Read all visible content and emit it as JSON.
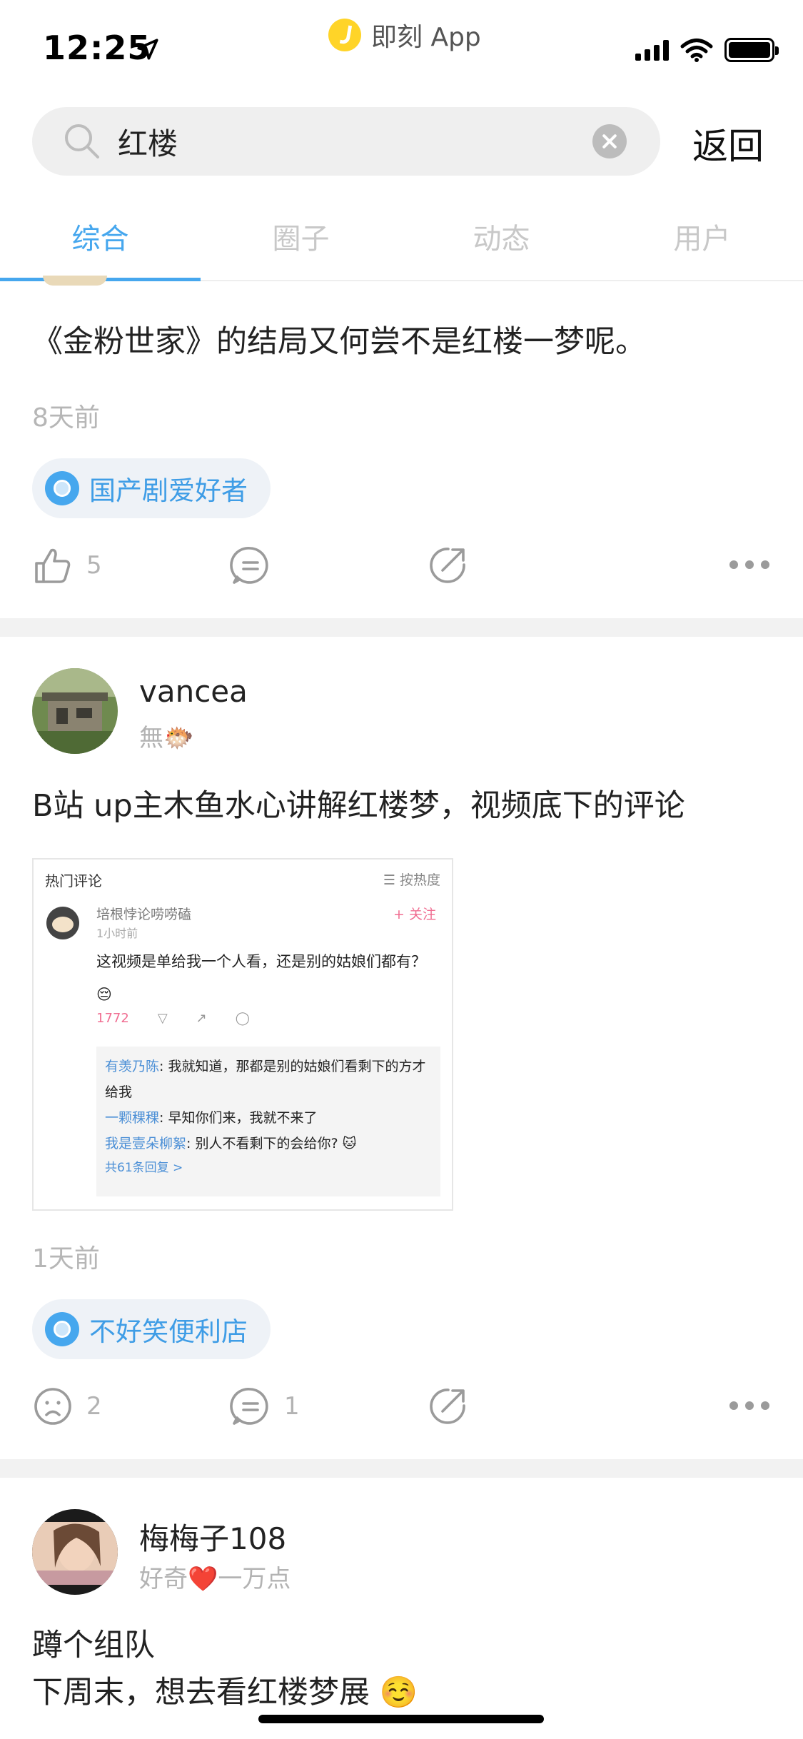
{
  "status_bar": {
    "time": "12:25",
    "app_name": "即刻 App"
  },
  "search": {
    "query": "红楼",
    "back_label": "返回"
  },
  "tabs": [
    {
      "label": "综合",
      "active": true
    },
    {
      "label": "圈子",
      "active": false
    },
    {
      "label": "动态",
      "active": false
    },
    {
      "label": "用户",
      "active": false
    }
  ],
  "colors": {
    "accent": "#46a7ee",
    "pill_bg": "#eef2f7",
    "muted": "#b6b6b6"
  },
  "posts": [
    {
      "text": "《金粉世家》的结局又何尝不是红楼一梦呢。",
      "time": "8天前",
      "topic": "国产剧爱好者",
      "like_count": "5",
      "comment_count": "",
      "like_icon": "thumbs-up-icon"
    },
    {
      "user": {
        "name": "vancea",
        "subtitle": "無🐡"
      },
      "text": "B站 up主木鱼水心讲解红楼梦，视频底下的评论",
      "image": {
        "header": "热门评论",
        "sort": "☰ 按热度",
        "commenter": "培根悖论唠唠磕",
        "comment_time": "1小时前",
        "follow": "+ 关注",
        "comment": "这视频是单给我一个人看，还是别的姑娘们都有？😔",
        "likes": "1772",
        "replies": [
          {
            "name": "有羡乃陈",
            "text": ": 我就知道，那都是别的姑娘们看剩下的方才给我"
          },
          {
            "name": "一颗稞稞",
            "text": ": 早知你们来，我就不来了"
          },
          {
            "name": "我是壹朵柳絮",
            "text": ": 别人不看剩下的会给你? 🐱"
          }
        ],
        "more_replies": "共61条回复 >"
      },
      "time": "1天前",
      "topic": "不好笑便利店",
      "like_count": "2",
      "comment_count": "1",
      "like_icon": "sad-face-icon"
    },
    {
      "user": {
        "name": "梅梅子108",
        "subtitle": "好奇❤️一万点"
      },
      "text_line1": "蹲个组队",
      "text_line2": "下周末，想去看红楼梦展 ☺️"
    }
  ]
}
